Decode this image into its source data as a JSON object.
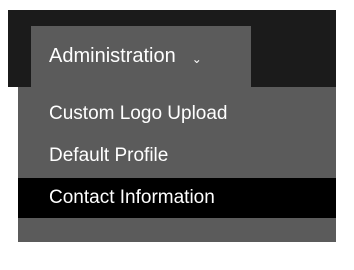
{
  "nav": {
    "admin_label": "Administration",
    "admin_chevron": "⌄"
  },
  "menu": {
    "items": [
      {
        "label": "Custom Logo Upload"
      },
      {
        "label": "Default Profile"
      },
      {
        "label": "Contact Information",
        "highlighted": true
      }
    ]
  },
  "colors": {
    "topbar": "#1b1b1b",
    "menu_bg": "#5b5b5b",
    "highlight": "#000000",
    "text": "#ffffff"
  }
}
